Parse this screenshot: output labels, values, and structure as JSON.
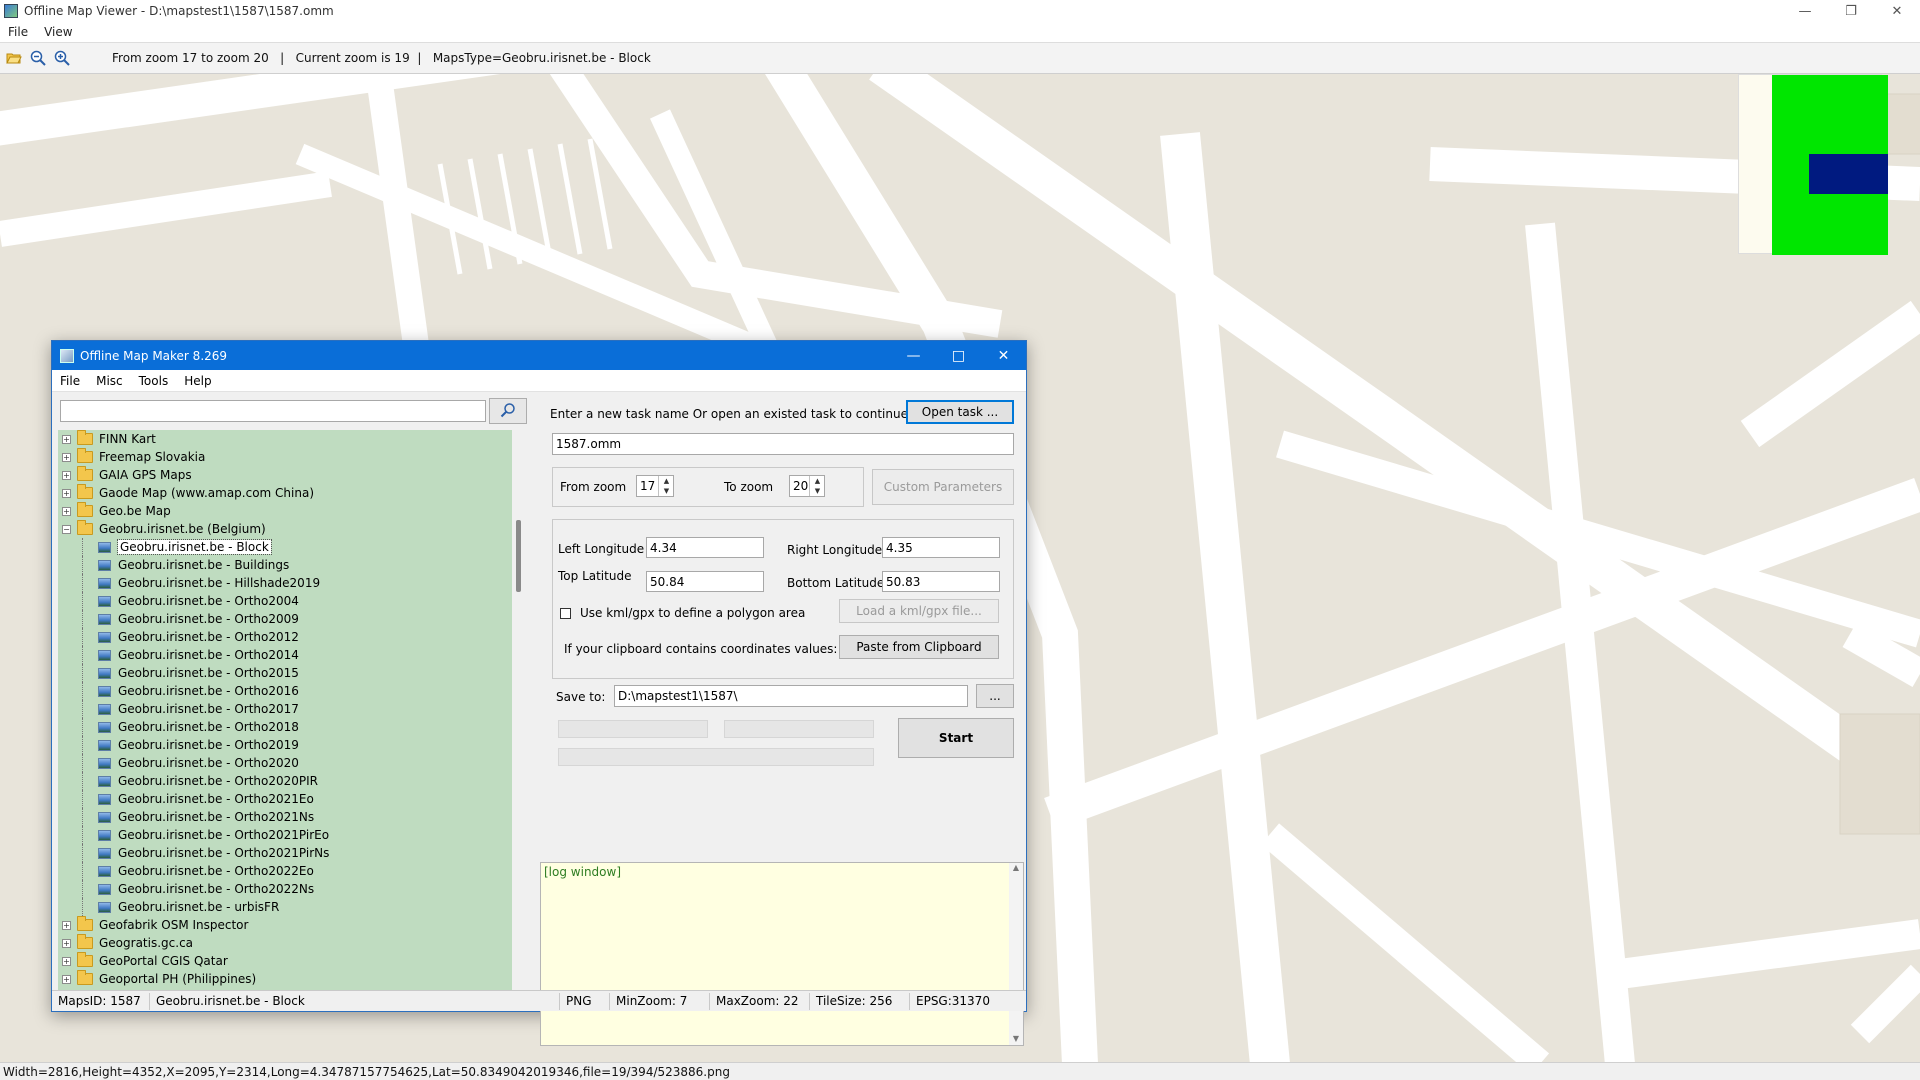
{
  "viewer": {
    "title": "Offline Map Viewer - D:\\mapstest1\\1587\\1587.omm",
    "menu": [
      "File",
      "View"
    ],
    "toolbar_info": "From zoom 17 to zoom 20   |   Current zoom is 19  |   MapsType=Geobru.irisnet.be - Block",
    "status": "Width=2816,Height=4352,X=2095,Y=2314,Long=4.34787157754625,Lat=50.8349042019346,file=19/394/523886.png",
    "icons": [
      "folder-open-icon",
      "zoom-out-icon",
      "zoom-in-icon"
    ]
  },
  "dialog": {
    "title": "Offline Map Maker 8.269",
    "menu": [
      "File",
      "Misc",
      "Tools",
      "Help"
    ],
    "search": {
      "value": "",
      "placeholder": ""
    },
    "tree": [
      {
        "label": "FINN Kart",
        "type": "folder",
        "expander": "+"
      },
      {
        "label": "Freemap Slovakia",
        "type": "folder",
        "expander": "+"
      },
      {
        "label": "GAIA GPS Maps",
        "type": "folder",
        "expander": "+"
      },
      {
        "label": "Gaode Map (www.amap.com China)",
        "type": "folder",
        "expander": "+"
      },
      {
        "label": "Geo.be Map",
        "type": "folder",
        "expander": "+"
      },
      {
        "label": "Geobru.irisnet.be (Belgium)",
        "type": "folder",
        "expander": "−"
      },
      {
        "label": "Geobru.irisnet.be - Block",
        "type": "leaf",
        "selected": true
      },
      {
        "label": "Geobru.irisnet.be - Buildings",
        "type": "leaf"
      },
      {
        "label": "Geobru.irisnet.be - Hillshade2019",
        "type": "leaf"
      },
      {
        "label": "Geobru.irisnet.be - Ortho2004",
        "type": "leaf"
      },
      {
        "label": "Geobru.irisnet.be - Ortho2009",
        "type": "leaf"
      },
      {
        "label": "Geobru.irisnet.be - Ortho2012",
        "type": "leaf"
      },
      {
        "label": "Geobru.irisnet.be - Ortho2014",
        "type": "leaf"
      },
      {
        "label": "Geobru.irisnet.be - Ortho2015",
        "type": "leaf"
      },
      {
        "label": "Geobru.irisnet.be - Ortho2016",
        "type": "leaf"
      },
      {
        "label": "Geobru.irisnet.be - Ortho2017",
        "type": "leaf"
      },
      {
        "label": "Geobru.irisnet.be - Ortho2018",
        "type": "leaf"
      },
      {
        "label": "Geobru.irisnet.be - Ortho2019",
        "type": "leaf"
      },
      {
        "label": "Geobru.irisnet.be - Ortho2020",
        "type": "leaf"
      },
      {
        "label": "Geobru.irisnet.be - Ortho2020PIR",
        "type": "leaf"
      },
      {
        "label": "Geobru.irisnet.be - Ortho2021Eo",
        "type": "leaf"
      },
      {
        "label": "Geobru.irisnet.be - Ortho2021Ns",
        "type": "leaf"
      },
      {
        "label": "Geobru.irisnet.be - Ortho2021PirEo",
        "type": "leaf"
      },
      {
        "label": "Geobru.irisnet.be - Ortho2021PirNs",
        "type": "leaf"
      },
      {
        "label": "Geobru.irisnet.be - Ortho2022Eo",
        "type": "leaf"
      },
      {
        "label": "Geobru.irisnet.be - Ortho2022Ns",
        "type": "leaf"
      },
      {
        "label": "Geobru.irisnet.be - urbisFR",
        "type": "leaf"
      },
      {
        "label": "Geofabrik OSM Inspector",
        "type": "folder",
        "expander": "+"
      },
      {
        "label": "Geogratis.gc.ca",
        "type": "folder",
        "expander": "+"
      },
      {
        "label": "GeoPortal CGIS Qatar",
        "type": "folder",
        "expander": "+"
      },
      {
        "label": "Geoportal PH (Philippines)",
        "type": "folder",
        "expander": "+"
      }
    ],
    "task": {
      "prompt": "Enter a new task name Or open an existed task to continue:",
      "open_button": "Open task ...",
      "name": "1587.omm"
    },
    "zoom": {
      "from_label": "From zoom",
      "from_value": "17",
      "to_label": "To zoom",
      "to_value": "20",
      "custom_button": "Custom Parameters"
    },
    "coords": {
      "left_lon_label": "Left Longitude",
      "left_lon": "4.34",
      "right_lon_label": "Right Longitude",
      "right_lon": "4.35",
      "top_lat_label": "Top Latitude",
      "top_lat": "50.84",
      "bottom_lat_label": "Bottom Latitude",
      "bottom_lat": "50.83",
      "kml_label": "Use kml/gpx to define a polygon area",
      "kml_checked": false,
      "kml_button": "Load a kml/gpx file...",
      "clipboard_label": "If your clipboard contains coordinates values:",
      "clipboard_button": "Paste from Clipboard"
    },
    "save": {
      "label": "Save to:",
      "path": "D:\\mapstest1\\1587\\",
      "browse_button": "...",
      "start_button": "Start"
    },
    "log": "[log window]",
    "status": {
      "maps_id": "MapsID: 1587",
      "map_name": "Geobru.irisnet.be - Block",
      "format": "PNG",
      "min_zoom": "MinZoom: 7",
      "max_zoom": "MaxZoom: 22",
      "tile_size": "TileSize: 256",
      "epsg": "EPSG:31370"
    }
  },
  "colors": {
    "map_land": "#e8e4da",
    "map_road": "#ffffff",
    "tree_bg": "#bfdcc0",
    "dialog_title_bar": "#0a6ed8",
    "log_bg": "#ffffe1",
    "minimap_green": "#00e600",
    "minimap_blue": "#001a80"
  }
}
